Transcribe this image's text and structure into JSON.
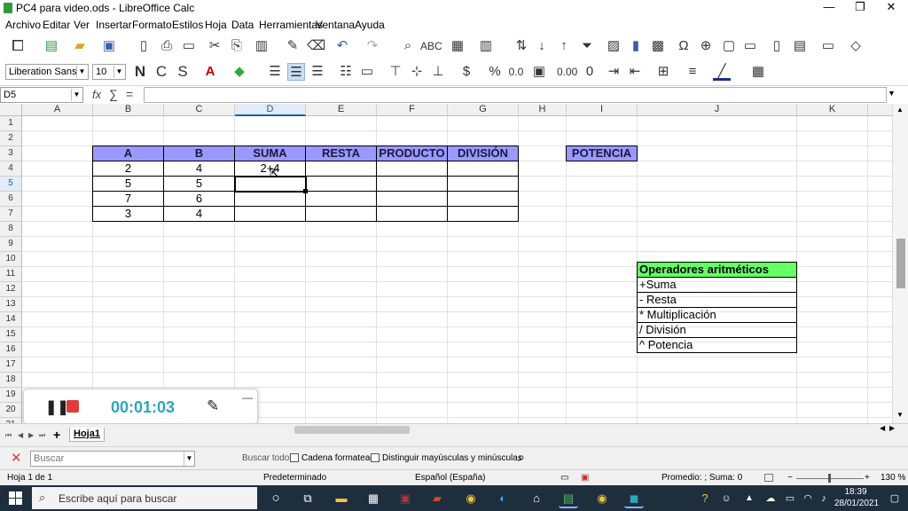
{
  "window": {
    "title": "PC4 para video.ods - LibreOffice Calc",
    "minimize": "—",
    "restore": "❐",
    "close": "✕"
  },
  "menu": [
    "Archivo",
    "Editar",
    "Ver",
    "Insertar",
    "Formato",
    "Estilos",
    "Hoja",
    "Data",
    "Herramientas",
    "Ventana",
    "Ayuda"
  ],
  "format_toolbar": {
    "font_name": "Liberation Sans",
    "font_size": "10",
    "bold": "N",
    "italic": "C",
    "underline": "S",
    "currency": "$",
    "percent": "%",
    "decimals_zero": "0.0",
    "add_decimal": "0.00"
  },
  "formula_bar": {
    "name_box": "D5",
    "fx": "fx",
    "sum": "∑",
    "equals": "=",
    "content": ""
  },
  "columns": [
    "A",
    "B",
    "C",
    "D",
    "E",
    "F",
    "G",
    "H",
    "I",
    "J",
    "K"
  ],
  "rows": [
    "1",
    "2",
    "3",
    "4",
    "5",
    "6",
    "7",
    "8",
    "9",
    "10",
    "11",
    "12",
    "13",
    "14",
    "15",
    "16",
    "17",
    "18",
    "19",
    "20",
    "21"
  ],
  "selected_cell": {
    "column": "D",
    "row": "5"
  },
  "table": {
    "headers": [
      "A",
      "B",
      "SUMA",
      "RESTA",
      "PRODUCTO",
      "DIVISIÓN"
    ],
    "potencia_header": "POTENCIA",
    "rows": [
      {
        "a": "2",
        "b": "4",
        "suma": "2+4"
      },
      {
        "a": "5",
        "b": "5",
        "suma": ""
      },
      {
        "a": "7",
        "b": "6",
        "suma": ""
      },
      {
        "a": "3",
        "b": "4",
        "suma": ""
      }
    ]
  },
  "operators": {
    "title": "Operadores aritméticos",
    "items": [
      "+Suma",
      "- Resta",
      "* Multiplicación",
      "/ División",
      "^ Potencia"
    ]
  },
  "recorder": {
    "time": "00:01:03",
    "minimize": "—"
  },
  "sheet_tabs": {
    "add": "+",
    "active": "Hoja1"
  },
  "findbar": {
    "close": "✕",
    "placeholder": "Buscar",
    "find_all": "Buscar todo",
    "formatted": "Cadena formateada",
    "match_case": "Distinguir mayúsculas y minúsculas"
  },
  "statusbar": {
    "sheet": "Hoja 1 de 1",
    "style": "Predeterminado",
    "language": "Español (España)",
    "summary": "Promedio: ; Suma: 0",
    "zoom": "130 %"
  },
  "taskbar": {
    "search_placeholder": "Escribe aquí para buscar",
    "time": "18:39",
    "date": "28/01/2021"
  },
  "colors": {
    "header_purple": "#9999ff",
    "operators_green": "#66ff66",
    "accent_teal": "#2aa8b8",
    "recorder_stop": "#e03b3b"
  }
}
